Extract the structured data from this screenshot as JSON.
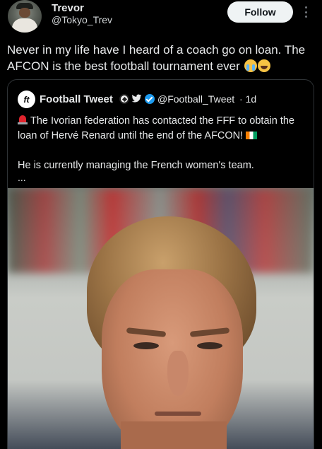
{
  "post": {
    "author_name": "Trevor",
    "author_handle": "@Tokyo_Trev",
    "follow_label": "Follow",
    "text": "Never in my life have I heard of a coach go on loan. The AFCON is the best football tournament ever"
  },
  "quote": {
    "avatar_text": "ft",
    "author_name": "Football Tweet",
    "author_handle": "@Football_Tweet",
    "time": "· 1d",
    "line1": "The Ivorian federation has contacted the FFF to obtain the loan of Hervé Renard until the end of the AFCON!",
    "line2": "He is currently managing the French women's team.",
    "more": "..."
  },
  "colors": {
    "background": "#000000",
    "text": "#e7e9ea",
    "follow_button": "#eff3f4",
    "verified": "#1d9bf0",
    "border": "#2f3336"
  }
}
